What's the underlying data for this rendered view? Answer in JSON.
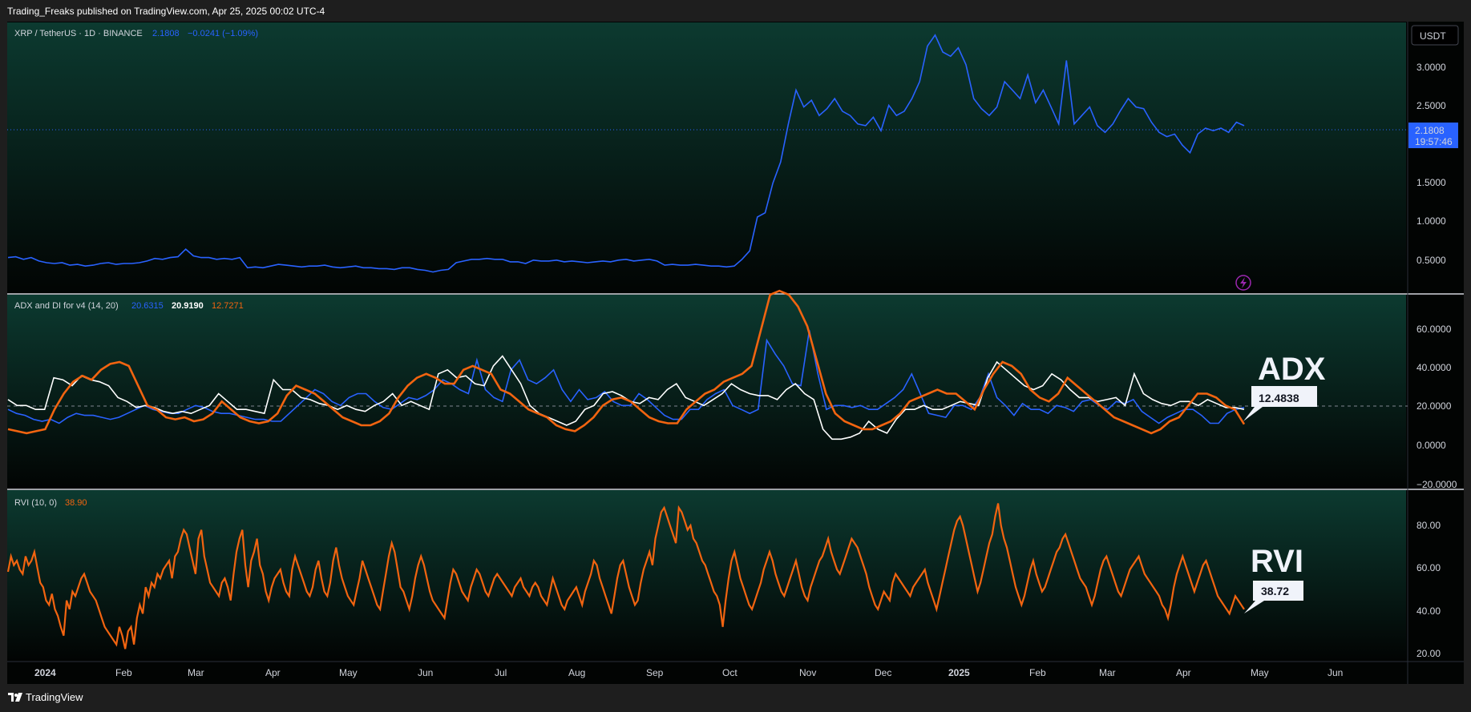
{
  "header": {
    "published": "Trading_Freaks published on TradingView.com, Apr 25, 2025 00:02 UTC-4"
  },
  "footer": {
    "brand": "TradingView"
  },
  "colors": {
    "price": "#2962ff",
    "adx": "#ffffff",
    "di_plus": "#2962ff",
    "di_minus": "#f26410",
    "rvi": "#f26410",
    "bg_top": "#0c3a30",
    "bg_bottom": "#030504",
    "divider": "#d1d4dc"
  },
  "main_pane": {
    "legend": {
      "symbol": "XRP / TetherUS · 1D · BINANCE",
      "price": "2.1808",
      "change": "−0.0241 (−1.09%)"
    },
    "currency_button": "USDT",
    "last_price_tag": "2.1808",
    "countdown": "19:57:46",
    "lightning-icon": "lightning-icon",
    "y_ticks": [
      "3.0000",
      "2.5000",
      "1.5000",
      "1.0000",
      "0.5000"
    ]
  },
  "adx_pane": {
    "legend": {
      "title": "ADX and DI for v4 (14, 20)",
      "v1": "20.6315",
      "v2": "20.9190",
      "v3": "12.7271"
    },
    "y_ticks": [
      "60.0000",
      "40.0000",
      "20.0000",
      "0.0000",
      "−20.0000"
    ],
    "annotation": "ADX",
    "annotation_value": "12.4838"
  },
  "rvi_pane": {
    "legend": {
      "title": "RVI (10, 0)",
      "value": "38.90"
    },
    "y_ticks": [
      "80.00",
      "60.00",
      "40.00",
      "20.00"
    ],
    "annotation": "RVI",
    "annotation_value": "38.72"
  },
  "x_axis": {
    "labels": [
      "2024",
      "Feb",
      "Mar",
      "Apr",
      "May",
      "Jun",
      "Jul",
      "Aug",
      "Sep",
      "Oct",
      "Nov",
      "Dec",
      "2025",
      "Feb",
      "Mar",
      "Apr",
      "May",
      "Jun"
    ]
  },
  "chart_data": [
    {
      "type": "line",
      "pane": "price",
      "x_start": "2023-12-20",
      "x_step_days": 3,
      "ylim": [
        0.2,
        3.4
      ],
      "series": [
        {
          "name": "XRP / TetherUS",
          "values": [
            0.62,
            0.63,
            0.6,
            0.62,
            0.58,
            0.56,
            0.55,
            0.56,
            0.53,
            0.54,
            0.52,
            0.53,
            0.55,
            0.56,
            0.54,
            0.55,
            0.55,
            0.56,
            0.58,
            0.61,
            0.6,
            0.62,
            0.63,
            0.72,
            0.64,
            0.62,
            0.62,
            0.6,
            0.61,
            0.6,
            0.62,
            0.5,
            0.51,
            0.5,
            0.52,
            0.54,
            0.53,
            0.52,
            0.51,
            0.52,
            0.52,
            0.53,
            0.51,
            0.5,
            0.51,
            0.52,
            0.5,
            0.5,
            0.49,
            0.49,
            0.48,
            0.5,
            0.5,
            0.48,
            0.47,
            0.45,
            0.47,
            0.48,
            0.56,
            0.58,
            0.6,
            0.6,
            0.61,
            0.6,
            0.6,
            0.57,
            0.57,
            0.55,
            0.59,
            0.58,
            0.58,
            0.59,
            0.57,
            0.58,
            0.57,
            0.56,
            0.57,
            0.58,
            0.57,
            0.59,
            0.6,
            0.58,
            0.59,
            0.6,
            0.58,
            0.53,
            0.54,
            0.53,
            0.53,
            0.54,
            0.53,
            0.52,
            0.52,
            0.51,
            0.52,
            0.6,
            0.7,
            1.1,
            1.15,
            1.5,
            1.75,
            2.2,
            2.6,
            2.4,
            2.48,
            2.3,
            2.38,
            2.5,
            2.35,
            2.3,
            2.2,
            2.18,
            2.28,
            2.12,
            2.42,
            2.3,
            2.35,
            2.5,
            2.7,
            3.12,
            3.25,
            3.05,
            3.0,
            3.1,
            2.9,
            2.5,
            2.38,
            2.3,
            2.4,
            2.7,
            2.6,
            2.5,
            2.78,
            2.45,
            2.6,
            2.4,
            2.2,
            2.95,
            2.2,
            2.3,
            2.4,
            2.18,
            2.1,
            2.2,
            2.36,
            2.5,
            2.4,
            2.38,
            2.22,
            2.1,
            2.05,
            2.08,
            1.95,
            1.86,
            2.08,
            2.15,
            2.12,
            2.15,
            2.1,
            2.22,
            2.18
          ]
        }
      ]
    },
    {
      "type": "line",
      "pane": "adx",
      "x_start": "2023-12-20",
      "x_step_days": 3,
      "ylim": [
        -20,
        78
      ],
      "series": [
        {
          "name": "blue",
          "values": [
            20,
            18,
            17,
            15,
            14,
            15,
            13,
            16,
            18,
            17,
            17,
            16,
            15,
            16,
            18,
            20,
            22,
            20,
            19,
            18,
            18,
            20,
            22,
            21,
            19,
            18,
            18,
            17,
            16,
            15,
            15,
            14,
            14,
            18,
            22,
            26,
            30,
            28,
            24,
            22,
            26,
            28,
            28,
            24,
            21,
            20,
            23,
            26,
            25,
            27,
            30,
            35,
            33,
            30,
            28,
            45,
            30,
            26,
            24,
            40,
            45,
            35,
            33,
            36,
            40,
            30,
            24,
            30,
            25,
            26,
            29,
            24,
            22,
            22,
            28,
            25,
            21,
            17,
            15,
            15,
            20,
            20,
            25,
            28,
            30,
            22,
            20,
            18,
            20,
            55,
            48,
            42,
            33,
            32,
            60,
            38,
            20,
            22,
            22,
            21,
            22,
            20,
            20,
            23,
            26,
            30,
            38,
            28,
            18,
            17,
            16,
            22,
            22,
            20,
            26,
            38,
            26,
            22,
            17,
            23,
            20,
            20,
            18,
            22,
            21,
            19,
            24,
            25,
            22,
            20,
            24,
            23,
            25,
            19,
            16,
            13,
            16,
            18,
            20,
            20,
            17,
            13,
            13,
            18,
            20,
            21
          ]
        },
        {
          "name": "white",
          "values": [
            25,
            22,
            22,
            20,
            20,
            36,
            35,
            32,
            37,
            35,
            34,
            32,
            26,
            24,
            21,
            22,
            21,
            19,
            18,
            19,
            18,
            20,
            22,
            28,
            24,
            20,
            20,
            19,
            18,
            35,
            30,
            30,
            26,
            25,
            23,
            22,
            20,
            22,
            20,
            19,
            22,
            24,
            28,
            22,
            24,
            22,
            20,
            38,
            40,
            36,
            37,
            33,
            32,
            42,
            47,
            40,
            33,
            22,
            18,
            16,
            14,
            12,
            14,
            20,
            22,
            28,
            29,
            27,
            24,
            23,
            26,
            25,
            30,
            33,
            26,
            24,
            22,
            25,
            28,
            33,
            30,
            28,
            27,
            27,
            25,
            30,
            33,
            28,
            25,
            10,
            5,
            5,
            6,
            8,
            14,
            10,
            8,
            15,
            20,
            20,
            22,
            20,
            20,
            22,
            24,
            23,
            22,
            36,
            44,
            40,
            36,
            32,
            30,
            32,
            38,
            35,
            30,
            26,
            26,
            24,
            25,
            26,
            22,
            38,
            28,
            25,
            23,
            22,
            24,
            24,
            22,
            25,
            23,
            21,
            21,
            20
          ]
        },
        {
          "name": "orange",
          "values": [
            10,
            9,
            8,
            9,
            10,
            20,
            28,
            34,
            37,
            35,
            40,
            43,
            44,
            42,
            32,
            22,
            20,
            16,
            15,
            16,
            14,
            15,
            18,
            24,
            20,
            16,
            14,
            13,
            14,
            18,
            27,
            32,
            30,
            28,
            24,
            20,
            16,
            14,
            12,
            12,
            14,
            18,
            26,
            32,
            36,
            38,
            36,
            33,
            33,
            40,
            42,
            40,
            38,
            30,
            28,
            24,
            20,
            18,
            16,
            12,
            10,
            9,
            12,
            16,
            22,
            25,
            26,
            24,
            20,
            16,
            14,
            13,
            13,
            20,
            24,
            28,
            30,
            34,
            36,
            38,
            42,
            60,
            78,
            80,
            78,
            72,
            62,
            45,
            28,
            18,
            14,
            12,
            10,
            10,
            12,
            14,
            18,
            24,
            26,
            28,
            30,
            28,
            28,
            24,
            20,
            30,
            38,
            44,
            42,
            38,
            30,
            26,
            24,
            28,
            36,
            32,
            28,
            24,
            20,
            16,
            14,
            12,
            10,
            8,
            10,
            14,
            16,
            22,
            28,
            28,
            26,
            22,
            20,
            12.5
          ]
        }
      ]
    },
    {
      "type": "line",
      "pane": "rvi",
      "x_start": "2023-12-20",
      "x_step_days": 1,
      "ylim": [
        15,
        92
      ],
      "series": [
        {
          "name": "RVI",
          "values": [
            55,
            62,
            58,
            60,
            56,
            54,
            62,
            58,
            60,
            64,
            57,
            50,
            48,
            42,
            40,
            45,
            38,
            35,
            30,
            26,
            42,
            38,
            46,
            44,
            48,
            52,
            54,
            50,
            46,
            44,
            42,
            38,
            34,
            30,
            28,
            26,
            24,
            22,
            30,
            26,
            20,
            28,
            30,
            22,
            34,
            40,
            36,
            48,
            44,
            50,
            48,
            54,
            52,
            56,
            58,
            60,
            52,
            62,
            64,
            70,
            74,
            72,
            66,
            60,
            54,
            70,
            74,
            62,
            56,
            50,
            48,
            46,
            44,
            50,
            52,
            48,
            42,
            54,
            64,
            70,
            74,
            58,
            48,
            60,
            64,
            70,
            58,
            54,
            46,
            42,
            48,
            52,
            54,
            56,
            50,
            46,
            44,
            56,
            62,
            58,
            54,
            50,
            46,
            44,
            48,
            56,
            60,
            52,
            46,
            44,
            50,
            60,
            66,
            58,
            52,
            48,
            44,
            42,
            40,
            46,
            52,
            60,
            56,
            52,
            48,
            44,
            40,
            38,
            46,
            54,
            62,
            68,
            64,
            56,
            48,
            46,
            42,
            38,
            44,
            52,
            58,
            62,
            58,
            52,
            46,
            42,
            40,
            38,
            36,
            34,
            42,
            50,
            56,
            54,
            50,
            46,
            44,
            42,
            48,
            52,
            56,
            54,
            50,
            46,
            44,
            48,
            52,
            54,
            52,
            50,
            48,
            46,
            44,
            48,
            50,
            52,
            48,
            46,
            44,
            48,
            50,
            48,
            44,
            42,
            40,
            46,
            52,
            48,
            44,
            40,
            38,
            42,
            44,
            46,
            48,
            44,
            40,
            46,
            50,
            54,
            60,
            58,
            52,
            48,
            44,
            40,
            36,
            44,
            52,
            58,
            60,
            54,
            48,
            44,
            40,
            42,
            50,
            56,
            60,
            64,
            58,
            70,
            76,
            82,
            84,
            80,
            76,
            72,
            68,
            84,
            82,
            78,
            74,
            76,
            70,
            68,
            64,
            60,
            58,
            54,
            50,
            46,
            44,
            40,
            30,
            42,
            52,
            60,
            64,
            58,
            52,
            48,
            44,
            40,
            38,
            42,
            46,
            50,
            56,
            60,
            64,
            60,
            54,
            50,
            46,
            44,
            48,
            52,
            56,
            60,
            54,
            48,
            44,
            42,
            48,
            52,
            56,
            60,
            62,
            66,
            70,
            64,
            60,
            56,
            54,
            58,
            62,
            66,
            70,
            68,
            66,
            62,
            58,
            54,
            48,
            44,
            40,
            38,
            42,
            46,
            44,
            42,
            50,
            54,
            52,
            50,
            48,
            46,
            44,
            48,
            50,
            52,
            54,
            56,
            50,
            46,
            42,
            38,
            44,
            50,
            56,
            62,
            68,
            74,
            78,
            80,
            76,
            70,
            64,
            58,
            52,
            46,
            50,
            56,
            62,
            68,
            72,
            80,
            86,
            76,
            70,
            66,
            60,
            54,
            48,
            44,
            40,
            44,
            50,
            56,
            60,
            54,
            50,
            46,
            48,
            52,
            56,
            60,
            64,
            66,
            70,
            72,
            68,
            64,
            60,
            56,
            52,
            50,
            48,
            44,
            40,
            44,
            50,
            56,
            60,
            62,
            58,
            54,
            50,
            46,
            44,
            48,
            52,
            56,
            58,
            60,
            62,
            58,
            54,
            52,
            50,
            48,
            46,
            44,
            40,
            38,
            34,
            40,
            48,
            54,
            58,
            62,
            58,
            54,
            50,
            46,
            50,
            54,
            58,
            60,
            56,
            52,
            48,
            44,
            42,
            40,
            38,
            36,
            40,
            44,
            42,
            40,
            38
          ]
        }
      ]
    }
  ]
}
